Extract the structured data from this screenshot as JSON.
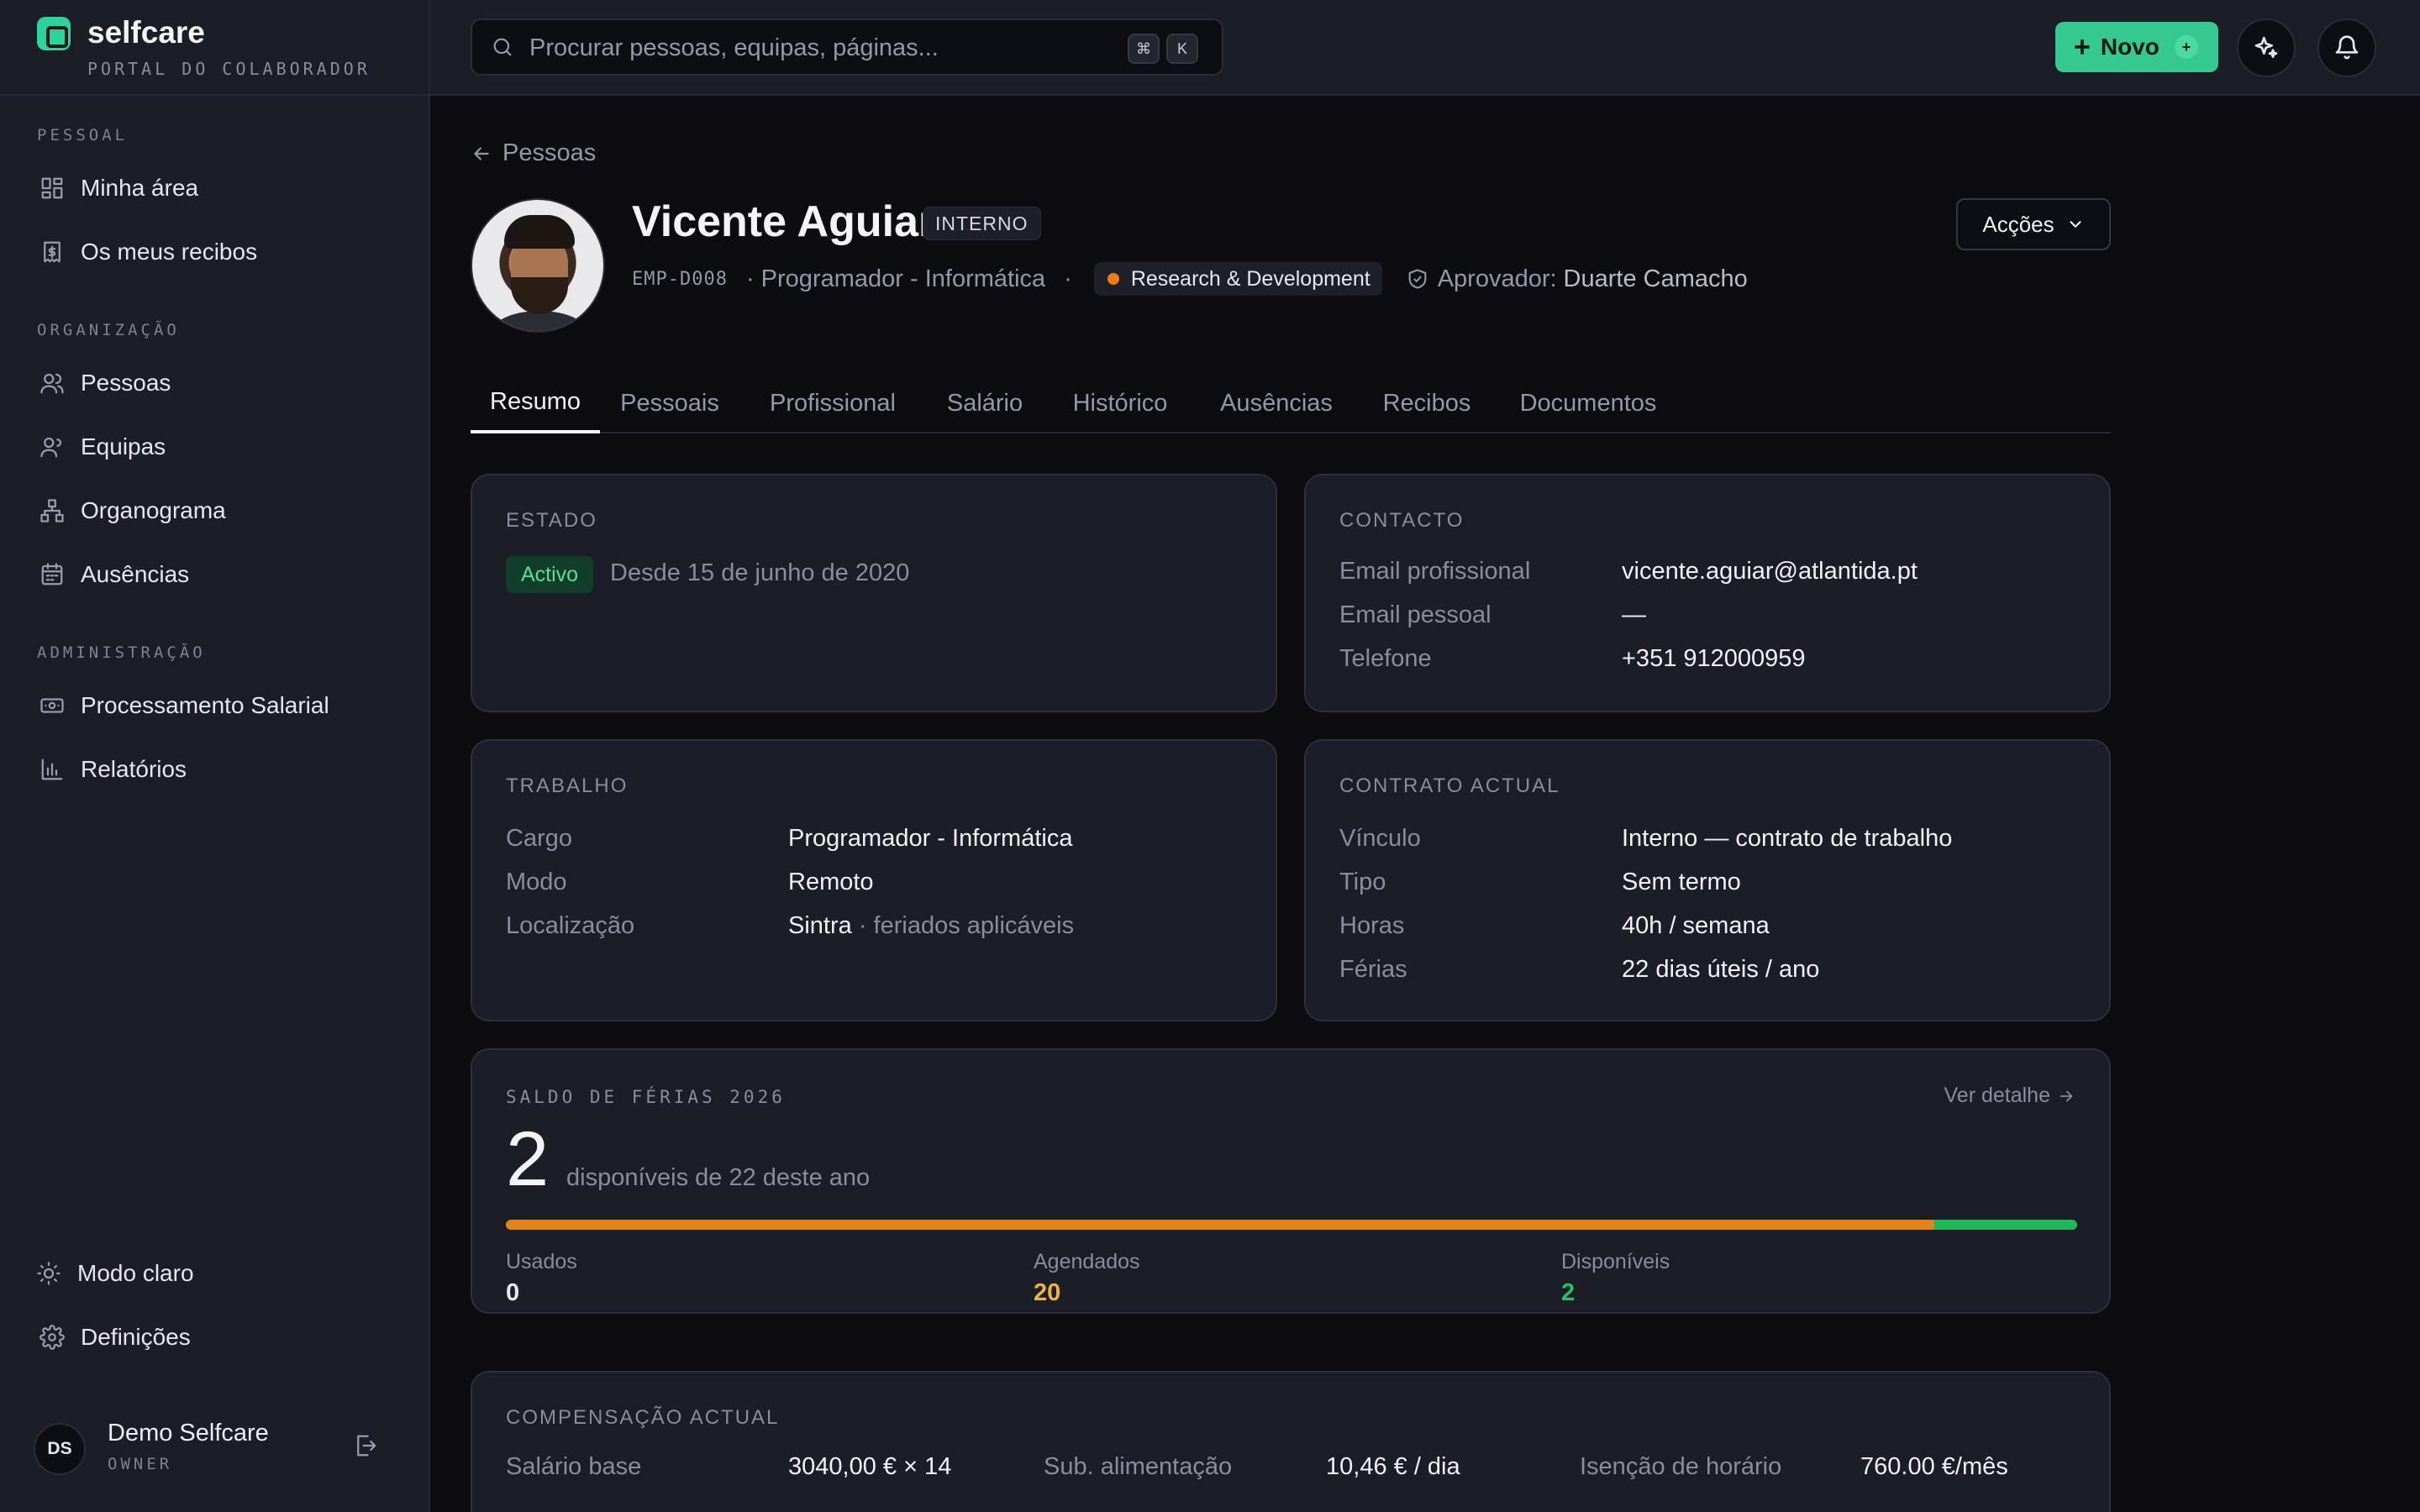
{
  "brand": {
    "name": "selfcare",
    "subtitle": "PORTAL DO COLABORADOR"
  },
  "sidebar": {
    "sections": [
      {
        "title": "PESSOAL"
      },
      {
        "title": "ORGANIZAÇÃO"
      },
      {
        "title": "ADMINISTRAÇÃO"
      }
    ],
    "items": [
      {
        "label": "Minha área",
        "icon": "grid-icon"
      },
      {
        "label": "Os meus recibos",
        "icon": "receipt-icon"
      },
      {
        "label": "Pessoas",
        "icon": "users-icon"
      },
      {
        "label": "Equipas",
        "icon": "team-icon"
      },
      {
        "label": "Organograma",
        "icon": "org-chart-icon"
      },
      {
        "label": "Ausências",
        "icon": "calendar-icon"
      },
      {
        "label": "Processamento Salarial",
        "icon": "money-icon"
      },
      {
        "label": "Relatórios",
        "icon": "bar-chart-icon"
      }
    ],
    "bottom": [
      {
        "label": "Modo claro",
        "icon": "sun-icon"
      },
      {
        "label": "Definições",
        "icon": "gear-icon"
      }
    ],
    "user": {
      "initials": "DS",
      "name": "Demo Selfcare",
      "role": "OWNER"
    }
  },
  "topbar": {
    "search_placeholder": "Procurar pessoas, equipas, páginas...",
    "shortcut_keys": [
      "⌘",
      "K"
    ],
    "new_label": "Novo"
  },
  "breadcrumb": "Pessoas",
  "profile": {
    "name": "Vicente Aguiar",
    "badge": "INTERNO",
    "code": "EMP-D008",
    "role": "· Programador - Informática",
    "separator": "·",
    "department": "Research & Development",
    "approver_label": "Aprovador:",
    "approver_name": "Duarte Camacho",
    "actions_label": "Acções"
  },
  "tabs": [
    "Resumo",
    "Pessoais",
    "Profissional",
    "Salário",
    "Histórico",
    "Ausências",
    "Recibos",
    "Documentos"
  ],
  "estado": {
    "title": "ESTADO",
    "status": "Activo",
    "since": "Desde 15 de junho de 2020"
  },
  "contacto": {
    "title": "CONTACTO",
    "rows": [
      {
        "label": "Email profissional",
        "value": "vicente.aguiar@atlantida.pt"
      },
      {
        "label": "Email pessoal",
        "value": "—"
      },
      {
        "label": "Telefone",
        "value": "+351 912000959"
      }
    ]
  },
  "trabalho": {
    "title": "TRABALHO",
    "rows": [
      {
        "label": "Cargo",
        "value": "Programador - Informática"
      },
      {
        "label": "Modo",
        "value": "Remoto"
      },
      {
        "label": "Localização",
        "value": "Sintra",
        "note": "· feriados aplicáveis"
      }
    ]
  },
  "contrato": {
    "title": "CONTRATO ACTUAL",
    "rows": [
      {
        "label": "Vínculo",
        "value": "Interno — contrato de trabalho"
      },
      {
        "label": "Tipo",
        "value": "Sem termo"
      },
      {
        "label": "Horas",
        "value": "40h / semana"
      },
      {
        "label": "Férias",
        "value": "22 dias úteis / ano"
      }
    ]
  },
  "saldo": {
    "title": "SALDO DE FÉRIAS 2026",
    "link": "Ver detalhe",
    "available": "2",
    "subtitle": "disponíveis de 22 deste ano",
    "total": 22,
    "stats": [
      {
        "label": "Usados",
        "value": "0",
        "color": "#e6e7ee",
        "days": 0
      },
      {
        "label": "Agendados",
        "value": "20",
        "color": "#f2b33d",
        "days": 20
      },
      {
        "label": "Disponíveis",
        "value": "2",
        "color": "#22c55e",
        "days": 2
      }
    ]
  },
  "compensacao": {
    "title": "COMPENSAÇÃO ACTUAL",
    "rows": [
      {
        "label": "Salário base",
        "value": "3040,00 € × 14"
      },
      {
        "label": "Sub. alimentação",
        "value": "10,46 € / dia"
      },
      {
        "label": "Isenção de horário",
        "value": "760.00 €/mês"
      }
    ]
  },
  "colors": {
    "accent": "#35c990",
    "department_dot": "#f07b1a",
    "status_active": "#57e09a"
  }
}
